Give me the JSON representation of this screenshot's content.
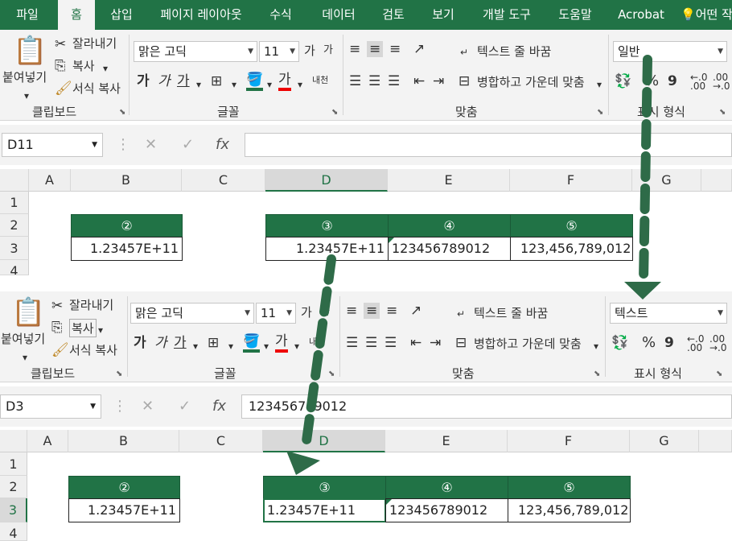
{
  "tabs": [
    "파일",
    "홈",
    "삽입",
    "페이지 레이아웃",
    "수식",
    "데이터",
    "검토",
    "보기",
    "개발 도구",
    "도움말",
    "Acrobat",
    "어떤 작"
  ],
  "clipboard": {
    "paste": "붙여넣기",
    "cut": "잘라내기",
    "copy": "복사",
    "format_painter": "서식 복사",
    "group": "클립보드"
  },
  "font": {
    "name": "맑은 고딕",
    "size": "11",
    "grow": "가",
    "shrink": "가",
    "bold": "가",
    "italic": "가",
    "underline": "가",
    "color_text": "가",
    "phonetic": "내천",
    "group": "글꼴"
  },
  "alignment": {
    "wrap": "텍스트 줄 바꿈",
    "merge": "병합하고 가운데 맞춤",
    "group": "맞춤"
  },
  "number": {
    "format_top": "일반",
    "format_bottom": "텍스트",
    "percent": "%",
    "comma": "9",
    "group": "표시 형식"
  },
  "top": {
    "namebox": "D11",
    "formula": ""
  },
  "bottom": {
    "namebox": "D3",
    "formula": "123456789012"
  },
  "sheet": {
    "columns": [
      "A",
      "B",
      "C",
      "D",
      "E",
      "F",
      "G"
    ],
    "rows": [
      "1",
      "2",
      "3",
      "4"
    ],
    "headers": [
      "②",
      "③",
      "④",
      "⑤"
    ],
    "top_values": {
      "b": "1.23457E+11",
      "d": "1.23457E+11",
      "e": "123456789012",
      "f": "123,456,789,012"
    },
    "bottom_values": {
      "b": "1.23457E+11",
      "d": "1.23457E+11",
      "e": "123456789012",
      "f": "123,456,789,012"
    }
  },
  "icons": {
    "fx": "fx",
    "cancel": "✕",
    "enter": "✓"
  },
  "colors": {
    "accent": "#217346"
  }
}
